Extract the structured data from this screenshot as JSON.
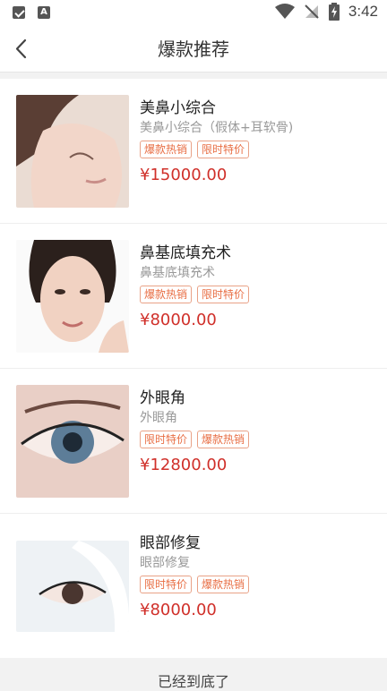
{
  "status_bar": {
    "time": "3:42",
    "icons": [
      "mail-notification-icon",
      "a-notification-icon",
      "wifi-icon",
      "no-signal-icon",
      "battery-charging-icon"
    ]
  },
  "header": {
    "title": "爆款推荐",
    "back_icon": "chevron-left-icon"
  },
  "products": [
    {
      "name": "美鼻小综合",
      "subtitle": "美鼻小综合（假体+耳软骨)",
      "tags": [
        "爆款热销",
        "限时特价"
      ],
      "price": "¥15000.00"
    },
    {
      "name": "鼻基底填充术",
      "subtitle": "鼻基底填充术",
      "tags": [
        "爆款热销",
        "限时特价"
      ],
      "price": "¥8000.00"
    },
    {
      "name": "外眼角",
      "subtitle": "外眼角",
      "tags": [
        "限时特价",
        "爆款热销"
      ],
      "price": "¥12800.00"
    },
    {
      "name": "眼部修复",
      "subtitle": "眼部修复",
      "tags": [
        "限时特价",
        "爆款热销"
      ],
      "price": "¥8000.00"
    }
  ],
  "footer": {
    "end_text": "已经到底了"
  },
  "colors": {
    "price": "#d0302a",
    "tag": "#e86e44",
    "tag_border": "#e9a287"
  }
}
